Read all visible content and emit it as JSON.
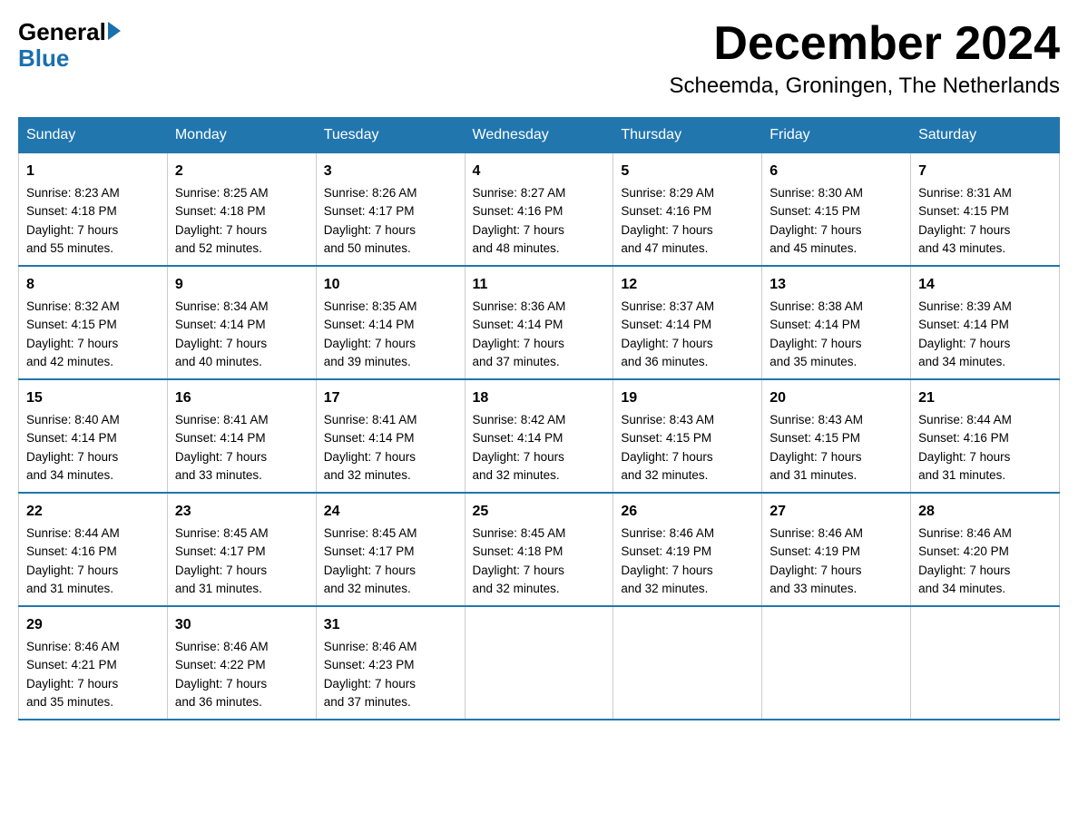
{
  "logo": {
    "general": "General",
    "blue": "Blue"
  },
  "title": "December 2024",
  "location": "Scheemda, Groningen, The Netherlands",
  "days_of_week": [
    "Sunday",
    "Monday",
    "Tuesday",
    "Wednesday",
    "Thursday",
    "Friday",
    "Saturday"
  ],
  "weeks": [
    [
      {
        "day": "1",
        "sunrise": "8:23 AM",
        "sunset": "4:18 PM",
        "daylight": "7 hours and 55 minutes."
      },
      {
        "day": "2",
        "sunrise": "8:25 AM",
        "sunset": "4:18 PM",
        "daylight": "7 hours and 52 minutes."
      },
      {
        "day": "3",
        "sunrise": "8:26 AM",
        "sunset": "4:17 PM",
        "daylight": "7 hours and 50 minutes."
      },
      {
        "day": "4",
        "sunrise": "8:27 AM",
        "sunset": "4:16 PM",
        "daylight": "7 hours and 48 minutes."
      },
      {
        "day": "5",
        "sunrise": "8:29 AM",
        "sunset": "4:16 PM",
        "daylight": "7 hours and 47 minutes."
      },
      {
        "day": "6",
        "sunrise": "8:30 AM",
        "sunset": "4:15 PM",
        "daylight": "7 hours and 45 minutes."
      },
      {
        "day": "7",
        "sunrise": "8:31 AM",
        "sunset": "4:15 PM",
        "daylight": "7 hours and 43 minutes."
      }
    ],
    [
      {
        "day": "8",
        "sunrise": "8:32 AM",
        "sunset": "4:15 PM",
        "daylight": "7 hours and 42 minutes."
      },
      {
        "day": "9",
        "sunrise": "8:34 AM",
        "sunset": "4:14 PM",
        "daylight": "7 hours and 40 minutes."
      },
      {
        "day": "10",
        "sunrise": "8:35 AM",
        "sunset": "4:14 PM",
        "daylight": "7 hours and 39 minutes."
      },
      {
        "day": "11",
        "sunrise": "8:36 AM",
        "sunset": "4:14 PM",
        "daylight": "7 hours and 37 minutes."
      },
      {
        "day": "12",
        "sunrise": "8:37 AM",
        "sunset": "4:14 PM",
        "daylight": "7 hours and 36 minutes."
      },
      {
        "day": "13",
        "sunrise": "8:38 AM",
        "sunset": "4:14 PM",
        "daylight": "7 hours and 35 minutes."
      },
      {
        "day": "14",
        "sunrise": "8:39 AM",
        "sunset": "4:14 PM",
        "daylight": "7 hours and 34 minutes."
      }
    ],
    [
      {
        "day": "15",
        "sunrise": "8:40 AM",
        "sunset": "4:14 PM",
        "daylight": "7 hours and 34 minutes."
      },
      {
        "day": "16",
        "sunrise": "8:41 AM",
        "sunset": "4:14 PM",
        "daylight": "7 hours and 33 minutes."
      },
      {
        "day": "17",
        "sunrise": "8:41 AM",
        "sunset": "4:14 PM",
        "daylight": "7 hours and 32 minutes."
      },
      {
        "day": "18",
        "sunrise": "8:42 AM",
        "sunset": "4:14 PM",
        "daylight": "7 hours and 32 minutes."
      },
      {
        "day": "19",
        "sunrise": "8:43 AM",
        "sunset": "4:15 PM",
        "daylight": "7 hours and 32 minutes."
      },
      {
        "day": "20",
        "sunrise": "8:43 AM",
        "sunset": "4:15 PM",
        "daylight": "7 hours and 31 minutes."
      },
      {
        "day": "21",
        "sunrise": "8:44 AM",
        "sunset": "4:16 PM",
        "daylight": "7 hours and 31 minutes."
      }
    ],
    [
      {
        "day": "22",
        "sunrise": "8:44 AM",
        "sunset": "4:16 PM",
        "daylight": "7 hours and 31 minutes."
      },
      {
        "day": "23",
        "sunrise": "8:45 AM",
        "sunset": "4:17 PM",
        "daylight": "7 hours and 31 minutes."
      },
      {
        "day": "24",
        "sunrise": "8:45 AM",
        "sunset": "4:17 PM",
        "daylight": "7 hours and 32 minutes."
      },
      {
        "day": "25",
        "sunrise": "8:45 AM",
        "sunset": "4:18 PM",
        "daylight": "7 hours and 32 minutes."
      },
      {
        "day": "26",
        "sunrise": "8:46 AM",
        "sunset": "4:19 PM",
        "daylight": "7 hours and 32 minutes."
      },
      {
        "day": "27",
        "sunrise": "8:46 AM",
        "sunset": "4:19 PM",
        "daylight": "7 hours and 33 minutes."
      },
      {
        "day": "28",
        "sunrise": "8:46 AM",
        "sunset": "4:20 PM",
        "daylight": "7 hours and 34 minutes."
      }
    ],
    [
      {
        "day": "29",
        "sunrise": "8:46 AM",
        "sunset": "4:21 PM",
        "daylight": "7 hours and 35 minutes."
      },
      {
        "day": "30",
        "sunrise": "8:46 AM",
        "sunset": "4:22 PM",
        "daylight": "7 hours and 36 minutes."
      },
      {
        "day": "31",
        "sunrise": "8:46 AM",
        "sunset": "4:23 PM",
        "daylight": "7 hours and 37 minutes."
      },
      null,
      null,
      null,
      null
    ]
  ]
}
